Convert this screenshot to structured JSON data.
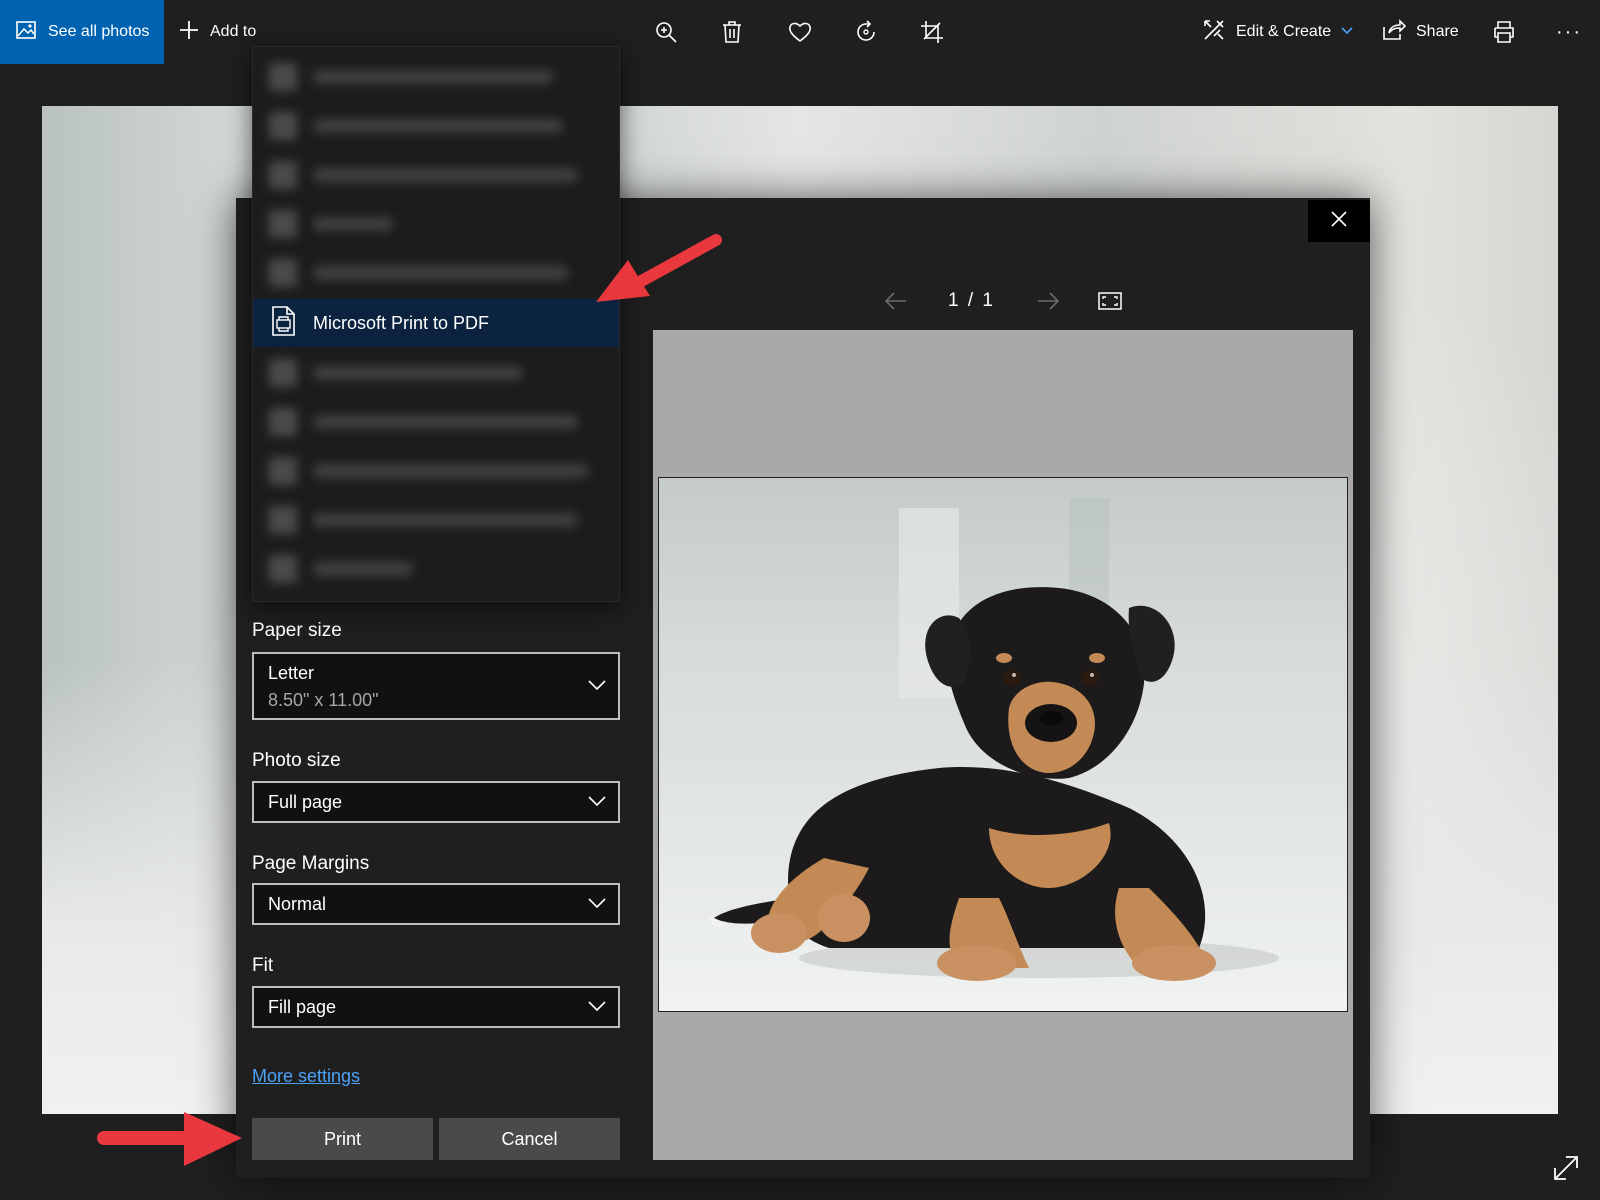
{
  "toolbar": {
    "see_all_label": "See all photos",
    "add_to_label": "Add to",
    "edit_create_label": "Edit & Create",
    "share_label": "Share",
    "more_label": "···"
  },
  "printer_list": {
    "selected_label": "Microsoft Print to PDF"
  },
  "dialog": {
    "paper_size_label": "Paper size",
    "paper_size_value": "Letter",
    "paper_size_sub": "8.50\" x 11.00\"",
    "photo_size_label": "Photo size",
    "photo_size_value": "Full page",
    "page_margins_label": "Page Margins",
    "page_margins_value": "Normal",
    "fit_label": "Fit",
    "fit_value": "Fill page",
    "more_settings": "More settings",
    "print_button": "Print",
    "cancel_button": "Cancel"
  },
  "preview": {
    "page_indicator": "1 / 1"
  },
  "colors": {
    "accent": "#0063b1",
    "selected_item": "#0c2340",
    "link": "#4ca2f5",
    "annotation_arrow": "#e8383d"
  }
}
